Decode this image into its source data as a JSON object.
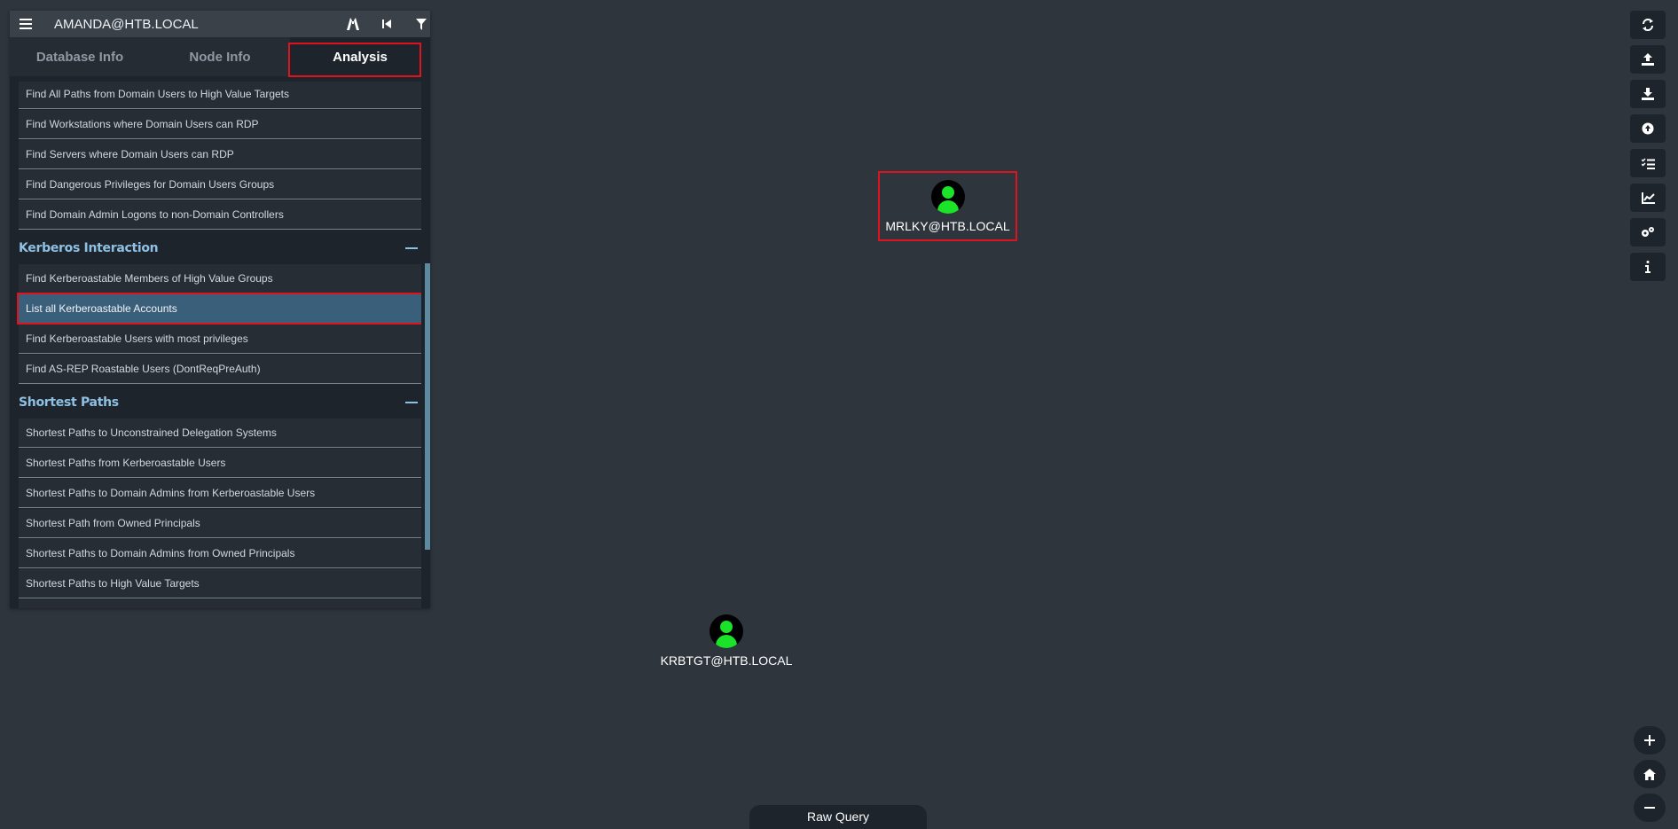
{
  "header": {
    "user": "AMANDA@HTB.LOCAL",
    "icons": [
      "menu-icon",
      "pathfinding-icon",
      "back-icon",
      "filter-icon"
    ]
  },
  "tabs": [
    {
      "label": "Database Info",
      "active": false
    },
    {
      "label": "Node Info",
      "active": false
    },
    {
      "label": "Analysis",
      "active": true
    }
  ],
  "analysis": {
    "top_items": [
      "Find All Paths from Domain Users to High Value Targets",
      "Find Workstations where Domain Users can RDP",
      "Find Servers where Domain Users can RDP",
      "Find Dangerous Privileges for Domain Users Groups",
      "Find Domain Admin Logons to non-Domain Controllers"
    ],
    "kerberos": {
      "title": "Kerberos Interaction",
      "items": [
        "Find Kerberoastable Members of High Value Groups",
        "List all Kerberoastable Accounts",
        "Find Kerberoastable Users with most privileges",
        "Find AS-REP Roastable Users (DontReqPreAuth)"
      ],
      "selected": "List all Kerberoastable Accounts"
    },
    "shortest": {
      "title": "Shortest Paths",
      "items": [
        "Shortest Paths to Unconstrained Delegation Systems",
        "Shortest Paths from Kerberoastable Users",
        "Shortest Paths to Domain Admins from Kerberoastable Users",
        "Shortest Path from Owned Principals",
        "Shortest Paths to Domain Admins from Owned Principals",
        "Shortest Paths to High Value Targets"
      ]
    }
  },
  "graph": {
    "nodes": [
      {
        "label": "MRLKY@HTB.LOCAL",
        "type": "user",
        "highlighted": true
      },
      {
        "label": "KRBTGT@HTB.LOCAL",
        "type": "user",
        "highlighted": false
      }
    ],
    "node_color": "#1ae32a"
  },
  "toolbar": {
    "icons": [
      "refresh-icon",
      "upload-icon",
      "download-icon",
      "upload-circle-icon",
      "queue-icon",
      "chart-icon",
      "settings-icon",
      "info-icon"
    ],
    "zoom": [
      "zoom-in-icon",
      "home-icon",
      "zoom-out-icon"
    ]
  },
  "raw_query": {
    "label": "Raw Query"
  },
  "colors": {
    "highlight": "#e0121e",
    "section_title": "#8fc0e3",
    "selected_row": "#3a5f7a"
  }
}
